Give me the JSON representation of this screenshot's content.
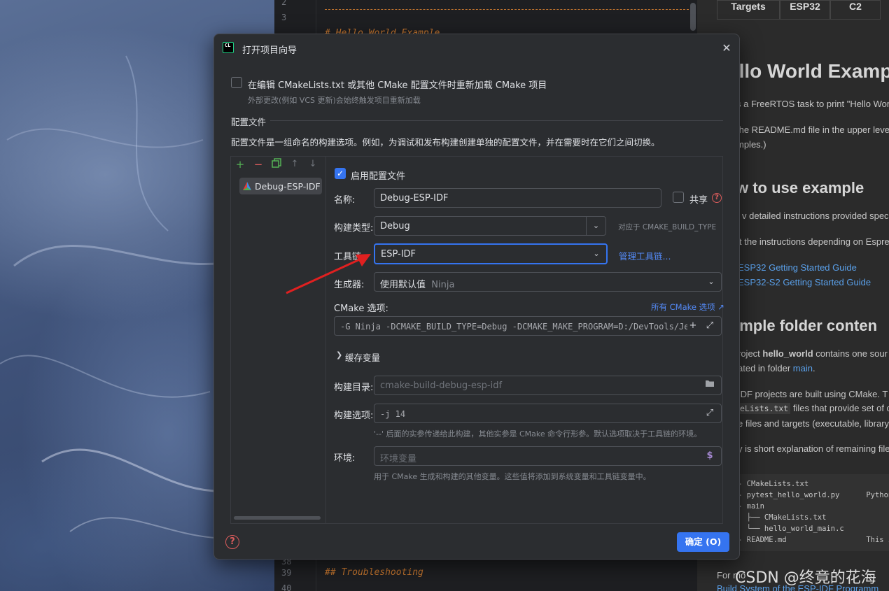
{
  "editor": {
    "line_numbers": [
      "2",
      "3",
      "38",
      "39",
      "40"
    ],
    "code_lines": [
      "# Hello World Example",
      "## Troubleshooting"
    ]
  },
  "preview": {
    "table_headers": [
      "Targets",
      "ESP32",
      "C2"
    ],
    "h1": "ello World Examp",
    "p1": "s a FreeRTOS task to print \"Hello Wor",
    "p2a": " the README.md file in the upper leve",
    "p2b": "mples.)",
    "h2_use": "w to use example",
    "p3": "v detailed instructions provided specit",
    "p4": "t the instructions depending on Espre",
    "link1": "ESP32 Getting Started Guide",
    "link2": "ESP32-S2 Getting Started Guide",
    "h2_folder": "ample folder conten",
    "p5_pre": "roject ",
    "p5_bold": "hello_world",
    "p5_post": " contains one sour",
    "p6_pre": "ated in folder ",
    "p6_link": "main",
    "p6_post": ".",
    "p7": "IDF projects are built using CMake. T",
    "p8_code": "eLists.txt",
    "p8_post": " files that provide set of c",
    "p9": "e files and targets (executable, library",
    "p10": "y is short explanation of remaining file",
    "tree": [
      "- CMakeLists.txt",
      "- pytest_hello_world.py      Python",
      "- main",
      "  ├── CMakeLists.txt",
      "  └── hello_world_main.c",
      "- README.md                  This is"
    ],
    "p11": "For mo",
    "p12": "Build System of the ESP-IDF Programm",
    "watermark": "CSDN @终竟的花海"
  },
  "dialog": {
    "title": "打开项目向导",
    "reload_label": "在编辑 CMakeLists.txt 或其他 CMake 配置文件时重新加载 CMake 项目",
    "reload_hint": "外部更改(例如 VCS 更新)会始终触发项目重新加载",
    "reload_checked": false,
    "section_title": "配置文件",
    "section_desc": "配置文件是一组命名的构建选项。例如，为调试和发布构建创建单独的配置文件，并在需要时在它们之间切换。",
    "profiles": [
      "Debug-ESP-IDF"
    ],
    "enable_profile_label": "启用配置文件",
    "enable_profile_checked": true,
    "name_label": "名称:",
    "name_value": "Debug-ESP-IDF",
    "share_label": "共享",
    "build_type_label": "构建类型:",
    "build_type_value": "Debug",
    "build_type_hint": "对应于 CMAKE_BUILD_TYPE",
    "toolchain_label": "工具链:",
    "toolchain_value": "ESP-IDF",
    "manage_toolchains": "管理工具链...",
    "generator_label": "生成器:",
    "generator_value": "使用默认值",
    "generator_hint": "Ninja",
    "cmake_options_label": "CMake 选项:",
    "all_cmake_options": "所有 CMake 选项",
    "cmake_options_value": "-G Ninja -DCMAKE_BUILD_TYPE=Debug -DCMAKE_MAKE_PROGRAM=D:/DevTools/Jet",
    "cache_vars_label": "缓存变量",
    "build_dir_label": "构建目录:",
    "build_dir_placeholder": "cmake-build-debug-esp-idf",
    "build_opts_label": "构建选项:",
    "build_opts_value": "-j 14",
    "build_opts_hint": "'--' 后面的实参传递给此构建，其他实参是 CMake 命令行形参。默认选项取决于工具链的环境。",
    "env_label": "环境:",
    "env_placeholder": "环境变量",
    "env_hint": "用于 CMake 生成和构建的其他变量。这些值将添加到系统变量和工具链变量中。",
    "ok_label": "确定 (O)"
  },
  "colors": {
    "accent": "#3574f0",
    "link": "#548af7",
    "annotation_arrow": "#e02020",
    "dialog_bg": "#2b2d30"
  }
}
